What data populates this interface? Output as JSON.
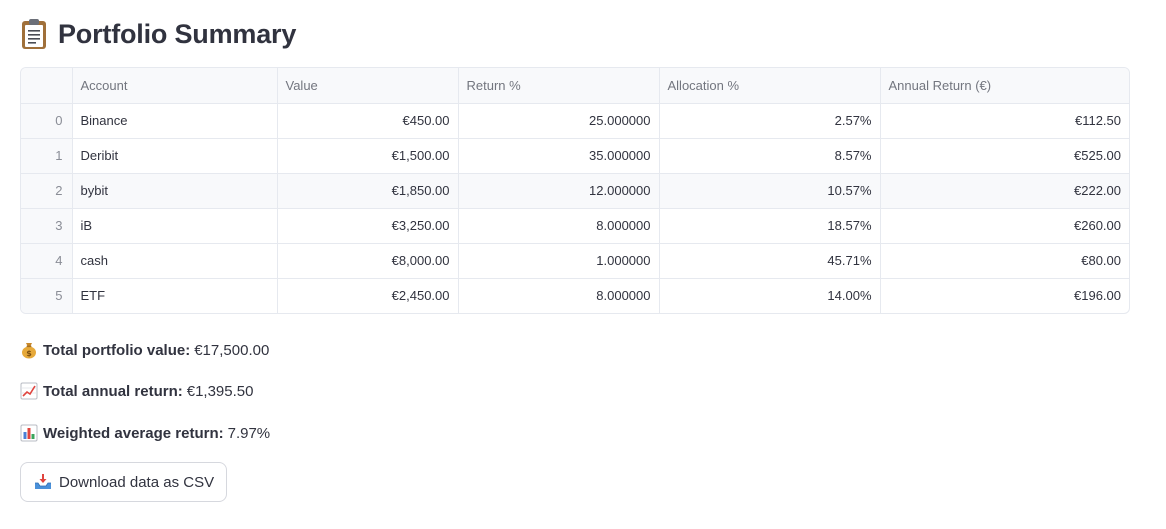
{
  "header": {
    "title": "Portfolio Summary",
    "icon": "clipboard-icon"
  },
  "table": {
    "columns": [
      "",
      "Account",
      "Value",
      "Return %",
      "Allocation %",
      "Annual Return (€)"
    ],
    "rows": [
      {
        "index": "0",
        "account": "Binance",
        "value": "€450.00",
        "return_pct": "25.000000",
        "allocation_pct": "2.57%",
        "annual_return": "€112.50"
      },
      {
        "index": "1",
        "account": "Deribit",
        "value": "€1,500.00",
        "return_pct": "35.000000",
        "allocation_pct": "8.57%",
        "annual_return": "€525.00"
      },
      {
        "index": "2",
        "account": "bybit",
        "value": "€1,850.00",
        "return_pct": "12.000000",
        "allocation_pct": "10.57%",
        "annual_return": "€222.00"
      },
      {
        "index": "3",
        "account": "iB",
        "value": "€3,250.00",
        "return_pct": "8.000000",
        "allocation_pct": "18.57%",
        "annual_return": "€260.00"
      },
      {
        "index": "4",
        "account": "cash",
        "value": "€8,000.00",
        "return_pct": "1.000000",
        "allocation_pct": "45.71%",
        "annual_return": "€80.00"
      },
      {
        "index": "5",
        "account": "ETF",
        "value": "€2,450.00",
        "return_pct": "8.000000",
        "allocation_pct": "14.00%",
        "annual_return": "€196.00"
      }
    ]
  },
  "summary": {
    "total_value": {
      "icon": "money-bag-icon",
      "label": "Total portfolio value:",
      "value": "€17,500.00"
    },
    "total_annual_return": {
      "icon": "chart-increasing-icon",
      "label": "Total annual return:",
      "value": "€1,395.50"
    },
    "weighted_avg_return": {
      "icon": "bar-chart-icon",
      "label": "Weighted average return:",
      "value": "7.97%"
    }
  },
  "download": {
    "label": "Download data as CSV",
    "icon": "inbox-tray-icon"
  },
  "colors": {
    "text": "#31333f",
    "header_bg": "#f8f9fb",
    "border": "#e6e9ef",
    "header_text": "#73767f"
  }
}
